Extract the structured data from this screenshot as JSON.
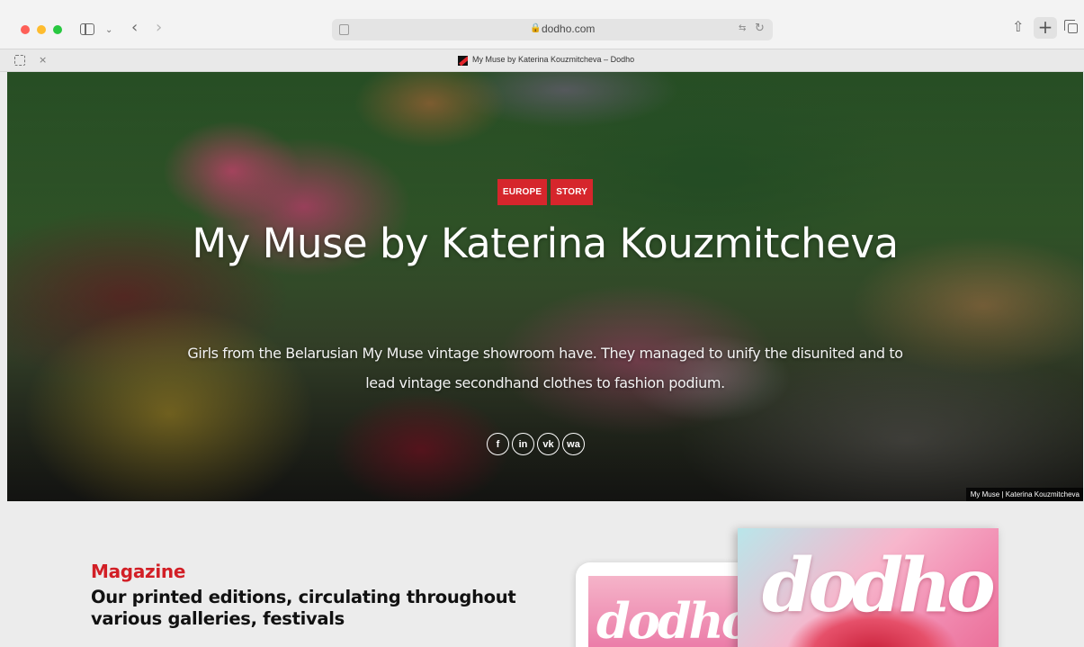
{
  "browser": {
    "url": "dodho.com",
    "tab_title": "My Muse by Katerina Kouzmitcheva – Dodho",
    "tab_close": "×",
    "icons": {
      "back": "chevron-left-icon",
      "forward": "chevron-right-icon",
      "share": "share-icon",
      "new_tab": "plus-icon",
      "tab_overview": "tabs-icon"
    },
    "back_glyph": "‹",
    "forward_glyph": "›",
    "new_tab_glyph": "+",
    "share_glyph": "⇧",
    "reload_glyph": "↻",
    "lock_glyph": "🔒",
    "dropdown_glyph": "⌄",
    "translate_glyph": "⇆"
  },
  "hero": {
    "tags": [
      "EUROPE",
      "STORY"
    ],
    "title": "My Muse by Katerina Kouzmitcheva",
    "subtitle": "Girls from the Belarusian My Muse vintage showroom have. They managed to unify the disunited and to lead vintage secondhand clothes to fashion podium.",
    "social": [
      "f",
      "in",
      "vk",
      "wa"
    ],
    "caption": "My Muse | Katerina Kouzmitcheva"
  },
  "magazine": {
    "label": "Magazine",
    "heading": "Our printed editions, circulating throughout various galleries, festivals",
    "tablet_logo": "dodho",
    "cover_logo": "dodho"
  },
  "colors": {
    "accent": "#d6262c",
    "label_red": "#d21f26"
  }
}
